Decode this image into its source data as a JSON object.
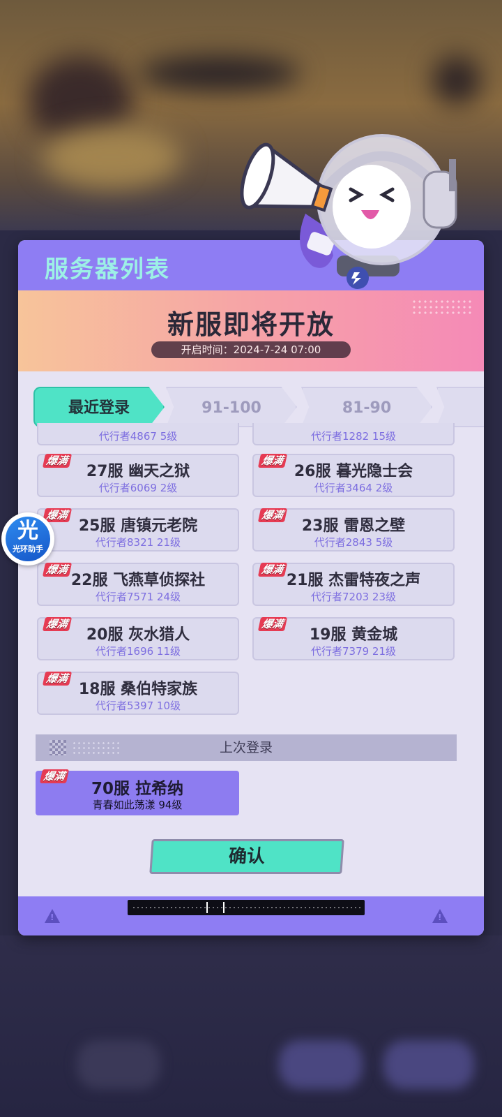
{
  "modal": {
    "title": "服务器列表",
    "banner_title": "新服即将开放",
    "banner_time": "开启时间：2024-7-24 07:00"
  },
  "tabs": [
    {
      "label": "最近登录",
      "active": true
    },
    {
      "label": "91-100",
      "active": false
    },
    {
      "label": "81-90",
      "active": false
    }
  ],
  "servers": {
    "partial_row": [
      {
        "sub": "代行者4867 5级"
      },
      {
        "sub": "代行者1282 15级"
      }
    ],
    "full_tag": "爆满",
    "items": [
      {
        "name": "27服 幽天之狱",
        "sub": "代行者6069 2级",
        "tag": "爆满"
      },
      {
        "name": "26服 暮光隐士会",
        "sub": "代行者3464 2级",
        "tag": "爆满"
      },
      {
        "name": "25服 唐镇元老院",
        "sub": "代行者8321 21级",
        "tag": "爆满"
      },
      {
        "name": "23服 雷恩之壁",
        "sub": "代行者2843 5级",
        "tag": "爆满"
      },
      {
        "name": "22服 飞燕草侦探社",
        "sub": "代行者7571 24级",
        "tag": "爆满"
      },
      {
        "name": "21服 杰雷特夜之声",
        "sub": "代行者7203 23级",
        "tag": "爆满"
      },
      {
        "name": "20服 灰水猎人",
        "sub": "代行者1696 11级",
        "tag": "爆满"
      },
      {
        "name": "19服 黄金城",
        "sub": "代行者7379 21级",
        "tag": "爆满"
      },
      {
        "name": "18服 桑伯特家族",
        "sub": "代行者5397 10级",
        "tag": "爆满"
      }
    ]
  },
  "last_login": {
    "header": "上次登录",
    "server": {
      "name": "70服 拉希纳",
      "sub": "青春如此荡漾 94级",
      "tag": "爆满"
    }
  },
  "confirm_label": "确认",
  "side_badge": {
    "glyph": "光",
    "label": "光环助手"
  },
  "colors": {
    "accent": "#4fe3c6",
    "header_purple": "#8e7df3",
    "title_cyan": "#9df0e6",
    "full_tag_red": "#e63b53"
  },
  "footer": {
    "warning_icon": "warning-icon"
  }
}
